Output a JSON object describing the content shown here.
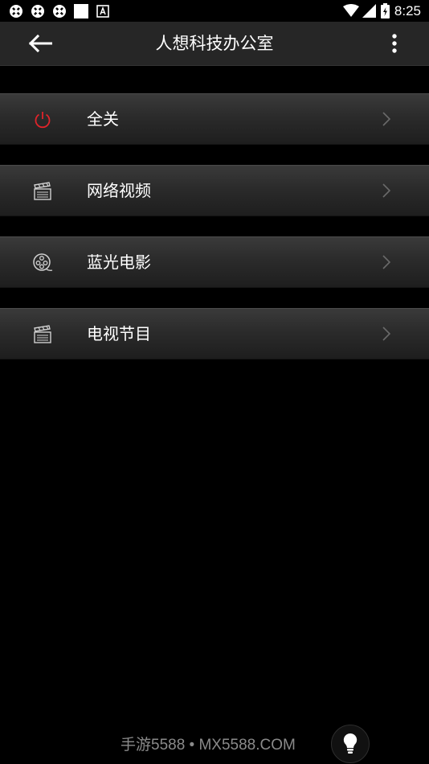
{
  "status_bar": {
    "time": "8:25",
    "left_icons": [
      "notification-icon",
      "notification-icon",
      "notification-icon",
      "square-notification-icon",
      "a-notification-icon"
    ],
    "right_icons": [
      "wifi-icon",
      "cell-signal-icon",
      "battery-charging-icon"
    ]
  },
  "app_bar": {
    "title": "人想科技办公室",
    "back_icon": "arrow-left-icon",
    "more_icon": "more-vertical-icon"
  },
  "menu": {
    "items": [
      {
        "label": "全关",
        "icon": "power-icon",
        "icon_color": "#e0242a"
      },
      {
        "label": "网络视频",
        "icon": "clapperboard-icon",
        "icon_color": "#d0d0d0"
      },
      {
        "label": "蓝光电影",
        "icon": "film-reel-icon",
        "icon_color": "#d0d0d0"
      },
      {
        "label": "电视节目",
        "icon": "clapperboard-icon",
        "icon_color": "#d0d0d0"
      }
    ]
  },
  "footer": {
    "watermark": "手游5588 • MX5588.COM",
    "bulb_icon": "lightbulb-icon"
  },
  "colors": {
    "background": "#000000",
    "app_bar": "#262626",
    "accent_red": "#e0242a"
  }
}
